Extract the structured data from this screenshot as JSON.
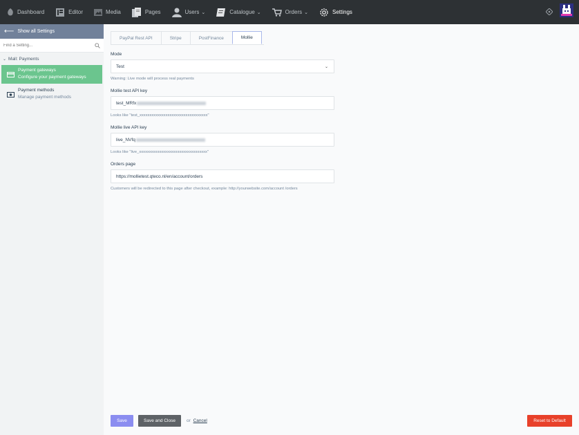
{
  "nav": {
    "items": [
      {
        "label": "Dashboard",
        "icon": "dashboard-icon"
      },
      {
        "label": "Editor",
        "icon": "editor-icon"
      },
      {
        "label": "Media",
        "icon": "media-icon"
      },
      {
        "label": "Pages",
        "icon": "pages-icon"
      },
      {
        "label": "Users",
        "icon": "users-icon",
        "dropdown": true
      },
      {
        "label": "Catalogue",
        "icon": "catalogue-icon",
        "dropdown": true
      },
      {
        "label": "Orders",
        "icon": "orders-icon",
        "dropdown": true
      },
      {
        "label": "Settings",
        "icon": "settings-icon",
        "active": true
      }
    ]
  },
  "sidebar": {
    "back_label": "Show all Settings",
    "search_placeholder": "Find a Setting...",
    "group_label": "Mall: Payments",
    "items": [
      {
        "title": "Payment gateways",
        "desc": "Configure your payment gateways",
        "active": true
      },
      {
        "title": "Payment methods",
        "desc": "Manage payment methods",
        "active": false
      }
    ]
  },
  "tabs": [
    "PayPal Rest API",
    "Stripe",
    "PostFinance",
    "Mollie"
  ],
  "form": {
    "mode": {
      "label": "Mode",
      "value": "Test",
      "help": "Warning: Live mode will process real payments"
    },
    "test_key": {
      "label": "Mollie test API key",
      "value": "test_MRfx",
      "help": "Looks like \"test_xxxxxxxxxxxxxxxxxxxxxxxxxxxxxxxxxx\""
    },
    "live_key": {
      "label": "Mollie live API key",
      "value": "live_NVfq",
      "help": "Looks like \"live_xxxxxxxxxxxxxxxxxxxxxxxxxxxxxxxxxx\""
    },
    "orders_page": {
      "label": "Orders page",
      "value": "https://mollietest.qteco.nl/en/account/orders",
      "help": "Customers will be redirected to this page after checkout, example: http://yourwebsite.com/account /orders"
    }
  },
  "footer": {
    "save": "Save",
    "save_close": "Save and Close",
    "or": "or",
    "cancel": "Cancel",
    "reset": "Reset to Default"
  },
  "colors": {
    "topbar": "#2d3134",
    "sidebar_header": "#71819a",
    "active_item": "#6bc58e",
    "save": "#8b8df0",
    "save_close": "#5e6266",
    "reset": "#e8412a"
  }
}
